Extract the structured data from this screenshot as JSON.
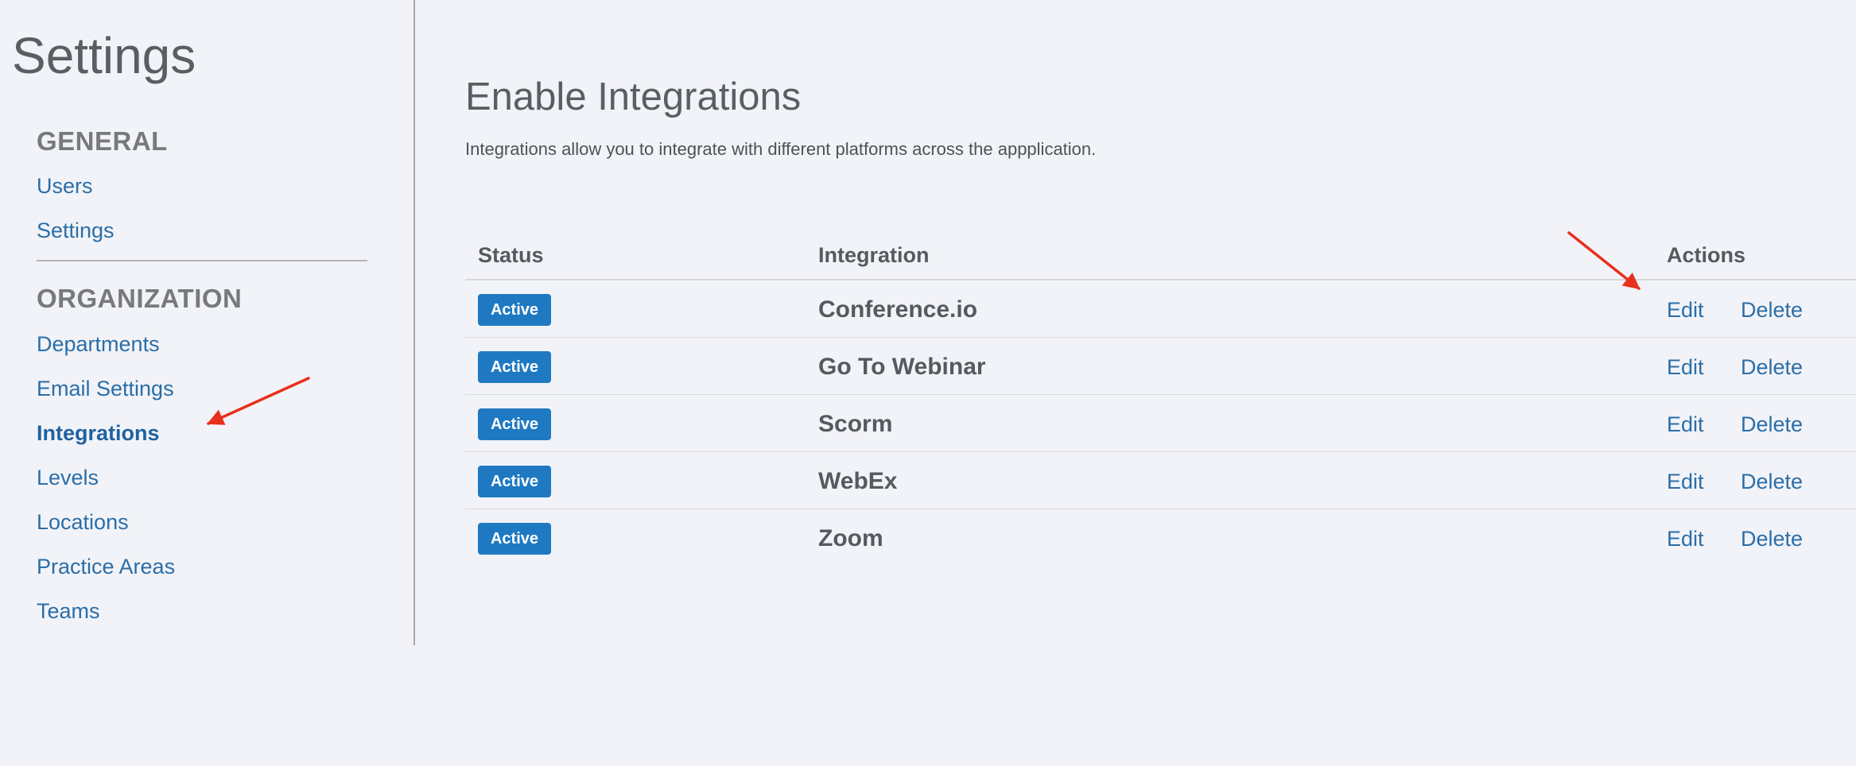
{
  "sidebar": {
    "title": "Settings",
    "sections": [
      {
        "heading": "GENERAL",
        "items": [
          {
            "label": "Users",
            "active": false
          },
          {
            "label": "Settings",
            "active": false
          }
        ]
      },
      {
        "heading": "ORGANIZATION",
        "items": [
          {
            "label": "Departments",
            "active": false
          },
          {
            "label": "Email Settings",
            "active": false
          },
          {
            "label": "Integrations",
            "active": true
          },
          {
            "label": "Levels",
            "active": false
          },
          {
            "label": "Locations",
            "active": false
          },
          {
            "label": "Practice Areas",
            "active": false
          },
          {
            "label": "Teams",
            "active": false
          }
        ]
      }
    ]
  },
  "main": {
    "title": "Enable Integrations",
    "description": "Integrations allow you to integrate with different platforms across the appplication.",
    "table": {
      "columns": [
        "Status",
        "Integration",
        "Actions"
      ],
      "rows": [
        {
          "status": "Active",
          "integration": "Conference.io",
          "edit": "Edit",
          "delete": "Delete"
        },
        {
          "status": "Active",
          "integration": "Go To Webinar",
          "edit": "Edit",
          "delete": "Delete"
        },
        {
          "status": "Active",
          "integration": "Scorm",
          "edit": "Edit",
          "delete": "Delete"
        },
        {
          "status": "Active",
          "integration": "WebEx",
          "edit": "Edit",
          "delete": "Delete"
        },
        {
          "status": "Active",
          "integration": "Zoom",
          "edit": "Edit",
          "delete": "Delete"
        }
      ]
    }
  },
  "annotations": {
    "arrow_color": "#e8301c",
    "arrows": [
      "pointer-to-integrations",
      "pointer-to-actions"
    ]
  },
  "colors": {
    "background": "#f2f3f8",
    "link": "#2a6ea8",
    "badge": "#1f79c2",
    "heading": "#77797c"
  }
}
